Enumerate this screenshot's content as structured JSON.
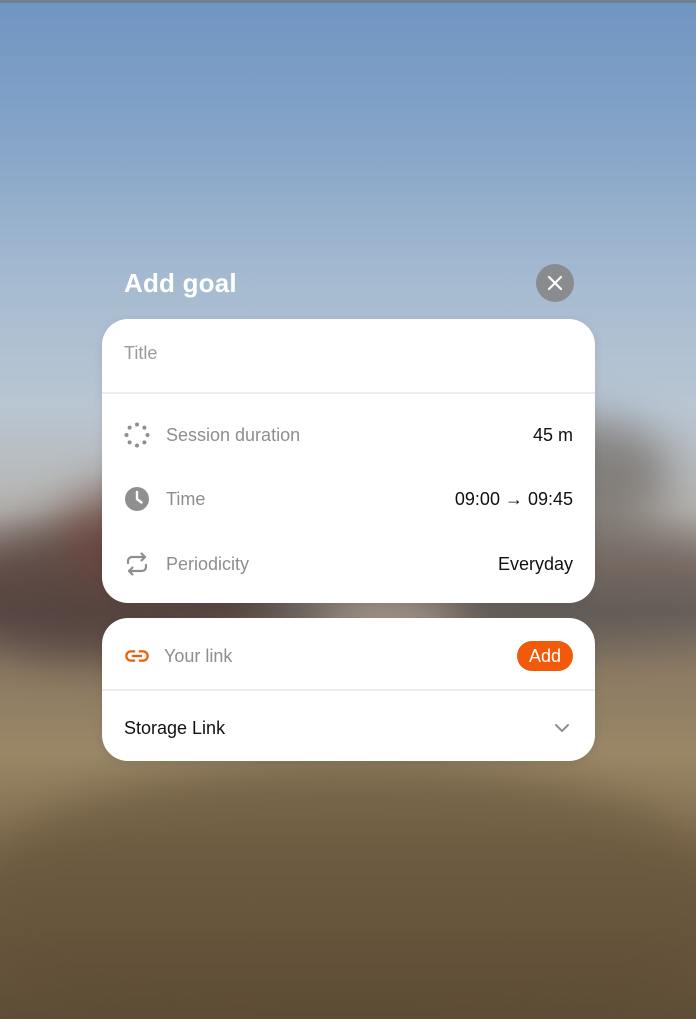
{
  "modal": {
    "title": "Add goal",
    "close_icon": "close-icon"
  },
  "main_card": {
    "title_placeholder": "Title",
    "rows": [
      {
        "label": "Session duration",
        "value": "45 m",
        "icon": "dotted-circle-icon"
      },
      {
        "label": "Time",
        "value": "09:00 → 09:45",
        "icon": "clock-icon"
      },
      {
        "label": "Periodicity",
        "value": "Everyday",
        "icon": "repeat-icon"
      }
    ]
  },
  "link_card": {
    "link_placeholder": "Your link",
    "link_icon": "link-icon",
    "add_label": "Add",
    "storage_label": "Storage Link",
    "storage_icon": "chevron-down-icon"
  },
  "colors": {
    "accent": "#F05A0A",
    "close_bg": "#8A8B8E",
    "muted_text": "#8E8E8E"
  }
}
